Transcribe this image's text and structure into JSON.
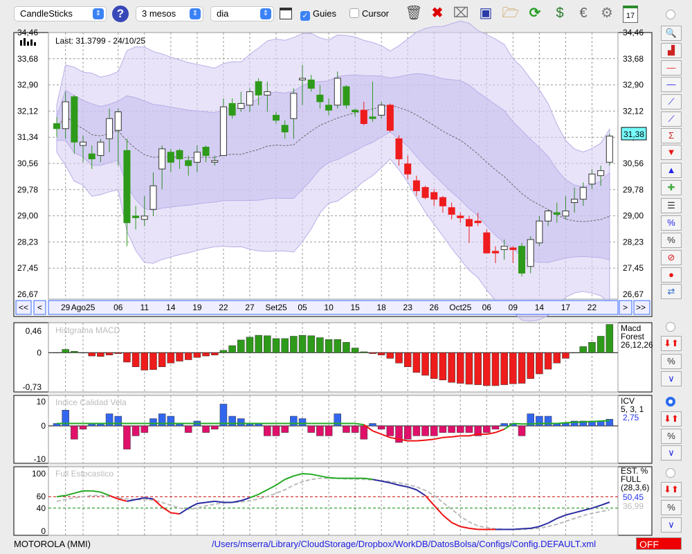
{
  "toolbar": {
    "chart_type": "CandleSticks",
    "period": "3 mesos",
    "interval": "dia",
    "guides_label": "Guies",
    "guides_checked": true,
    "cursor_label": "Cursor",
    "cursor_checked": false,
    "icons": [
      "trash-icon",
      "delete-icon",
      "lamp-icon",
      "save-icon",
      "folder-open-icon",
      "refresh-icon",
      "dollar-refresh-icon",
      "euro-icon",
      "gear-icon",
      "calendar-icon"
    ],
    "calendar_day": "17"
  },
  "price": {
    "last_label": "Last: 31.3799 - 24/10/25",
    "current": "31,38",
    "y_labels": [
      "34,46",
      "33,68",
      "32,90",
      "32,12",
      "31,34",
      "30,56",
      "29,78",
      "29,00",
      "28,23",
      "27,45",
      "26,67"
    ],
    "ymin": 26.67,
    "ymax": 34.46
  },
  "nav": {
    "first": "<<",
    "prev": "<",
    "dates": [
      "29",
      "Ago25",
      "06",
      "11",
      "14",
      "19",
      "22",
      "27",
      "Set25",
      "05",
      "10",
      "15",
      "18",
      "23",
      "26",
      "Oct25",
      "06",
      "09",
      "14",
      "17",
      "22"
    ],
    "date_idx": [
      1,
      3,
      7,
      10,
      13,
      16,
      19,
      22,
      25,
      28,
      31,
      34,
      37,
      40,
      43,
      46,
      49,
      52,
      55,
      58,
      61
    ],
    "next": ">",
    "last": ">>"
  },
  "candles": [
    [
      31.75,
      31.95,
      31.35,
      31.6,
      "g"
    ],
    [
      31.6,
      32.7,
      31.3,
      32.4,
      "w"
    ],
    [
      32.55,
      32.6,
      30.85,
      31.2,
      "g"
    ],
    [
      31.1,
      31.4,
      30.6,
      31.2,
      "w"
    ],
    [
      30.85,
      31.1,
      30.4,
      30.7,
      "g"
    ],
    [
      30.8,
      31.3,
      30.6,
      31.2,
      "w"
    ],
    [
      31.3,
      32.2,
      30.9,
      31.9,
      "w"
    ],
    [
      31.55,
      32.2,
      30.5,
      32.1,
      "w"
    ],
    [
      30.95,
      31.3,
      28.1,
      28.8,
      "g"
    ],
    [
      29.0,
      29.3,
      28.6,
      28.95,
      "g"
    ],
    [
      28.9,
      29.6,
      28.7,
      29.0,
      "w"
    ],
    [
      29.2,
      30.3,
      29.0,
      29.9,
      "w"
    ],
    [
      30.4,
      31.1,
      29.8,
      31.0,
      "w"
    ],
    [
      30.9,
      31.0,
      30.3,
      30.6,
      "g"
    ],
    [
      30.95,
      31.0,
      30.4,
      30.7,
      "g"
    ],
    [
      30.65,
      30.8,
      30.2,
      30.5,
      "g"
    ],
    [
      30.6,
      31.1,
      30.3,
      30.9,
      "w"
    ],
    [
      31.05,
      31.1,
      30.6,
      30.8,
      "g"
    ],
    [
      30.6,
      30.8,
      30.5,
      30.65,
      "w"
    ],
    [
      30.8,
      32.5,
      30.8,
      32.25,
      "w"
    ],
    [
      32.35,
      32.5,
      31.9,
      32.0,
      "g"
    ],
    [
      32.2,
      32.7,
      32.1,
      32.35,
      "w"
    ],
    [
      32.3,
      32.8,
      32.1,
      32.7,
      "w"
    ],
    [
      33.0,
      33.1,
      32.3,
      32.6,
      "g"
    ],
    [
      32.6,
      33.0,
      32.1,
      32.7,
      "w"
    ],
    [
      32.0,
      32.1,
      31.75,
      31.85,
      "g"
    ],
    [
      31.7,
      31.85,
      31.3,
      31.5,
      "g"
    ],
    [
      31.9,
      32.8,
      31.3,
      32.65,
      "w"
    ],
    [
      33.05,
      33.5,
      32.3,
      33.1,
      "w"
    ],
    [
      33.05,
      33.2,
      32.7,
      32.8,
      "g"
    ],
    [
      32.6,
      32.9,
      32.2,
      32.4,
      "g"
    ],
    [
      32.3,
      32.5,
      32.0,
      32.15,
      "g"
    ],
    [
      32.3,
      33.3,
      32.2,
      33.1,
      "w"
    ],
    [
      32.85,
      32.9,
      32.2,
      32.3,
      "g"
    ],
    [
      32.15,
      32.2,
      31.95,
      32.1,
      "g"
    ],
    [
      32.15,
      32.4,
      31.7,
      31.75,
      "r"
    ],
    [
      31.95,
      33.0,
      31.8,
      31.9,
      "g"
    ],
    [
      32.0,
      32.4,
      31.9,
      32.3,
      "w"
    ],
    [
      32.3,
      32.35,
      31.5,
      31.55,
      "r"
    ],
    [
      31.3,
      31.4,
      30.5,
      30.7,
      "r"
    ],
    [
      30.55,
      30.8,
      30.1,
      30.25,
      "r"
    ],
    [
      30.05,
      30.2,
      29.6,
      29.75,
      "r"
    ],
    [
      29.85,
      29.9,
      29.5,
      29.55,
      "r"
    ],
    [
      29.7,
      29.8,
      29.3,
      29.5,
      "r"
    ],
    [
      29.55,
      29.6,
      29.1,
      29.3,
      "r"
    ],
    [
      29.25,
      29.4,
      28.9,
      29.05,
      "r"
    ],
    [
      29.0,
      29.1,
      28.8,
      28.95,
      "r"
    ],
    [
      28.9,
      29.0,
      28.2,
      28.7,
      "r"
    ],
    [
      28.85,
      29.1,
      28.7,
      28.8,
      "r"
    ],
    [
      28.5,
      28.6,
      27.9,
      27.9,
      "r"
    ],
    [
      27.95,
      28.1,
      27.6,
      27.9,
      "r"
    ],
    [
      28.0,
      28.3,
      27.7,
      28.1,
      "w"
    ],
    [
      28.05,
      28.1,
      27.6,
      28.0,
      "r"
    ],
    [
      28.1,
      28.2,
      27.2,
      27.3,
      "g"
    ],
    [
      27.5,
      28.4,
      27.3,
      28.3,
      "w"
    ],
    [
      28.2,
      29.0,
      28.1,
      28.85,
      "w"
    ],
    [
      28.85,
      29.2,
      28.7,
      29.15,
      "w"
    ],
    [
      29.1,
      29.4,
      28.8,
      29.05,
      "g"
    ],
    [
      29.0,
      29.6,
      28.9,
      29.15,
      "w"
    ],
    [
      29.4,
      29.85,
      29.1,
      29.5,
      "w"
    ],
    [
      29.5,
      30.0,
      29.3,
      29.85,
      "w"
    ],
    [
      29.95,
      30.4,
      29.8,
      30.25,
      "w"
    ],
    [
      30.2,
      30.5,
      29.9,
      30.35,
      "w"
    ],
    [
      30.6,
      31.45,
      30.5,
      31.38,
      "w"
    ]
  ],
  "macd": {
    "title": "Histgrama MACD",
    "name": "Macd",
    "name2": "Forest",
    "params": "26,12,26",
    "y_labels": [
      "0,46",
      "0",
      "-0,73"
    ],
    "ymax": 0.46,
    "ymin": -0.73,
    "values": [
      0,
      0.07,
      0.03,
      0,
      -0.07,
      -0.08,
      -0.05,
      -0.02,
      -0.2,
      -0.3,
      -0.37,
      -0.36,
      -0.3,
      -0.22,
      -0.18,
      -0.15,
      -0.1,
      -0.07,
      -0.05,
      0.05,
      0.15,
      0.27,
      0.33,
      0.37,
      0.36,
      0.3,
      0.3,
      0.35,
      0.37,
      0.36,
      0.32,
      0.28,
      0.28,
      0.22,
      0.1,
      0.02,
      -0.02,
      -0.05,
      -0.12,
      -0.22,
      -0.3,
      -0.42,
      -0.48,
      -0.55,
      -0.58,
      -0.63,
      -0.65,
      -0.67,
      -0.68,
      -0.7,
      -0.7,
      -0.68,
      -0.66,
      -0.65,
      -0.55,
      -0.45,
      -0.35,
      -0.22,
      -0.12,
      0,
      0.13,
      0.22,
      0.35,
      0.6
    ]
  },
  "icv": {
    "title": "Indice Calidad Vela",
    "name": "ICV",
    "params": "5, 3, 1",
    "value": "2,75",
    "y_labels": [
      "10",
      "0",
      "-10"
    ],
    "ymax": 10,
    "ymin": -10,
    "values": [
      1,
      6.5,
      -4,
      -1,
      1,
      1,
      5,
      4,
      -7,
      -3,
      -2,
      3,
      5,
      4,
      1,
      -2,
      2,
      -2,
      -1,
      9,
      4,
      3,
      1,
      1,
      -3,
      -3,
      -2,
      4,
      3,
      -2,
      -3,
      -3,
      5,
      -2,
      -2,
      -4,
      1,
      -1,
      -3,
      -5,
      -4,
      -3,
      -3,
      -3,
      -2,
      -2,
      -2,
      -2,
      -3,
      -2,
      -1,
      1,
      1,
      -3,
      5,
      4,
      4,
      1,
      1,
      2,
      2,
      2,
      2,
      2.75
    ],
    "line": [
      1,
      1,
      1,
      1,
      1,
      1,
      1,
      1,
      1,
      1,
      1,
      1,
      1,
      1,
      1,
      1,
      1,
      1,
      1,
      1,
      1,
      1,
      1,
      1,
      1,
      1,
      1,
      1,
      1,
      1,
      1,
      1,
      1,
      1,
      1,
      0.5,
      -1.5,
      -2.5,
      -3.5,
      -4,
      -4.5,
      -4.5,
      -4.3,
      -4,
      -3.5,
      -3.3,
      -3,
      -3,
      -2.5,
      -2.5,
      -2,
      -1,
      1,
      0.8,
      0.8,
      1,
      1,
      1,
      1.3,
      1.5,
      1.6,
      1.8,
      2,
      2.2
    ]
  },
  "stoch": {
    "title": "Full Estocastico",
    "name": "EST. %",
    "name2": "FULL",
    "params": "(28,3,6)",
    "k_value": "50,45",
    "d_value": "36,99",
    "y_labels": [
      "100",
      "60",
      "40",
      "0"
    ],
    "levels": [
      60,
      40
    ],
    "k": [
      60,
      62,
      66,
      70,
      70,
      68,
      62,
      56,
      52,
      55,
      58,
      56,
      42,
      32,
      30,
      40,
      48,
      50,
      52,
      50,
      50,
      53,
      58,
      64,
      72,
      80,
      90,
      96,
      100,
      99,
      96,
      93,
      92,
      92,
      92,
      92,
      90,
      87,
      84,
      80,
      77,
      72,
      62,
      45,
      28,
      15,
      8,
      5,
      3,
      3,
      3,
      3,
      3,
      4,
      5,
      8,
      14,
      22,
      28,
      32,
      36,
      40,
      45,
      50.45
    ],
    "d": [
      52,
      55,
      58,
      60,
      62,
      62,
      60,
      58,
      56,
      55,
      55,
      54,
      50,
      45,
      40,
      38,
      40,
      44,
      47,
      49,
      50,
      51,
      53,
      56,
      60,
      66,
      72,
      80,
      86,
      90,
      92,
      92,
      92,
      91,
      91,
      90,
      89,
      88,
      86,
      84,
      81,
      77,
      71,
      62,
      50,
      38,
      26,
      16,
      9,
      6,
      4,
      3,
      3,
      3,
      4,
      5,
      8,
      12,
      17,
      22,
      27,
      31,
      34,
      36.99
    ]
  },
  "status": {
    "symbol": "MOTOROLA (MMI)",
    "path": "/Users/mserra/Library/CloudStorage/Dropbox/WorkDB/DatosBolsa/Configs/Config.DEFAULT.xml",
    "off": "OFF"
  },
  "colors": {
    "green": "#2e9a1a",
    "red": "#ee1c1c",
    "blue": "#3366ee",
    "pink": "#e0106a",
    "band": "#d8d0f4",
    "band_inner": "#c8bff0"
  }
}
